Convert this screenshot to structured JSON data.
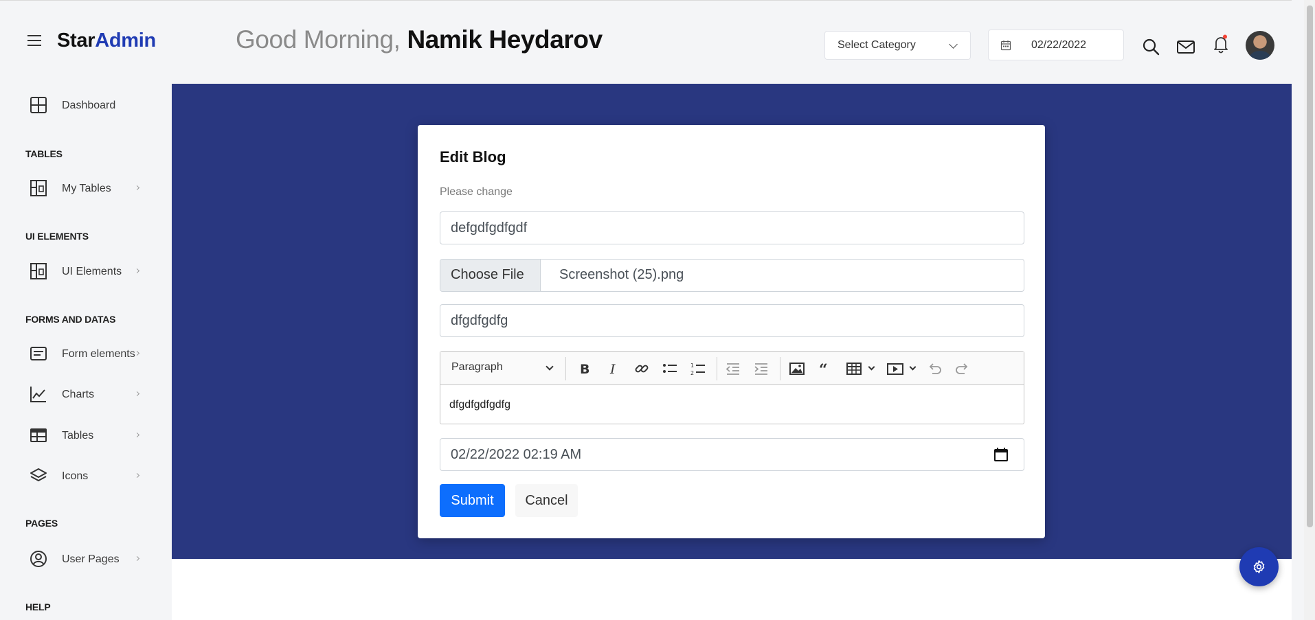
{
  "brand": {
    "part1": "Star",
    "part2": "Admin"
  },
  "header": {
    "greeting_prefix": "Good Morning, ",
    "user_name": "Namik Heydarov",
    "category_select": "Select Category",
    "date": "02/22/2022"
  },
  "sidebar": {
    "dashboard": "Dashboard",
    "sections": {
      "tables": "TABLES",
      "ui_elements": "UI ELEMENTS",
      "forms": "FORMS AND DATAS",
      "pages": "PAGES",
      "help": "HELP"
    },
    "items": {
      "my_tables": "My Tables",
      "ui_elements": "UI Elements",
      "form_elements": "Form elements",
      "charts": "Charts",
      "tables": "Tables",
      "icons": "Icons",
      "user_pages": "User Pages"
    }
  },
  "form": {
    "title": "Edit Blog",
    "description": "Please change",
    "title_value": "defgdfgdfgdf",
    "choose_file": "Choose File",
    "file_name": "Screenshot (25).png",
    "subtitle_value": "dfgdfgdfg",
    "editor_block_style": "Paragraph",
    "editor_content": "dfgdfgdfgdfg",
    "datetime_value": "02/22/2022 02:19  AM",
    "submit_label": "Submit",
    "cancel_label": "Cancel"
  },
  "colors": {
    "brand_accent": "#1f3bb3",
    "banner": "#293780",
    "primary_button": "#0d6efd"
  }
}
